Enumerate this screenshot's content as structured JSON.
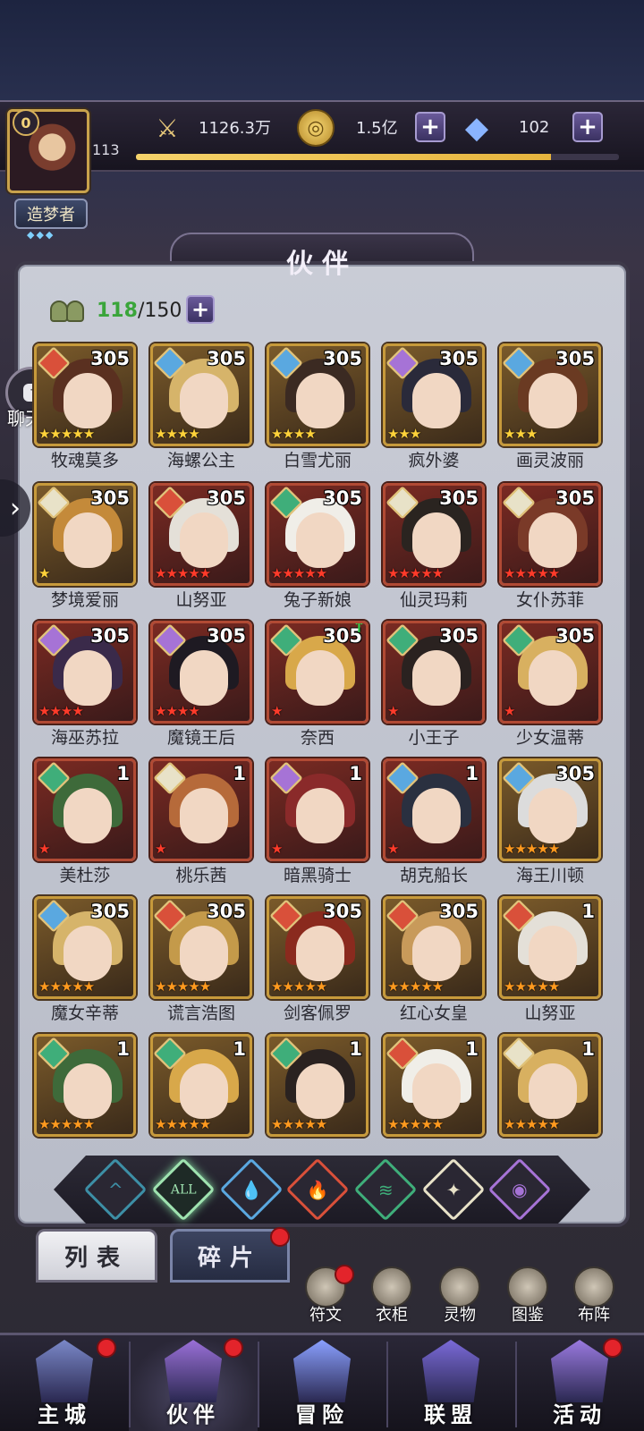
{
  "player": {
    "vip": "0",
    "level": "113",
    "title": "造梦者"
  },
  "resources": {
    "power": "1126.3万",
    "gold": "1.5亿",
    "gems": "102"
  },
  "exp_progress": 0.86,
  "header": {
    "title": "伙伴"
  },
  "roster": {
    "current": "118",
    "max": "/150"
  },
  "chat": {
    "label": "聊天",
    "bubble": "···"
  },
  "heroes": [
    {
      "name": "牧魂莫多",
      "level": "305",
      "stars": 5,
      "star_color": "gold",
      "element": "fire",
      "frame": "gold",
      "hair": "#5a3020"
    },
    {
      "name": "海螺公主",
      "level": "305",
      "stars": 4,
      "star_color": "gold",
      "element": "water",
      "frame": "gold",
      "hair": "#d6b46a"
    },
    {
      "name": "白雪尤丽",
      "level": "305",
      "stars": 4,
      "star_color": "gold",
      "element": "water",
      "frame": "gold",
      "hair": "#3b2a22"
    },
    {
      "name": "疯外婆",
      "level": "305",
      "stars": 3,
      "star_color": "gold",
      "element": "dark",
      "frame": "gold",
      "hair": "#2a2a3a"
    },
    {
      "name": "画灵波丽",
      "level": "305",
      "stars": 3,
      "star_color": "gold",
      "element": "water",
      "frame": "gold",
      "hair": "#6a3a22"
    },
    {
      "name": "梦境爱丽",
      "level": "305",
      "stars": 1,
      "star_color": "gold",
      "element": "light",
      "frame": "gold",
      "hair": "#c48a3a"
    },
    {
      "name": "山努亚",
      "level": "305",
      "stars": 5,
      "star_color": "red",
      "element": "fire",
      "frame": "red",
      "hair": "#e4e0d8"
    },
    {
      "name": "兔子新娘",
      "level": "305",
      "stars": 5,
      "star_color": "red",
      "element": "wind",
      "frame": "red",
      "hair": "#f0eee8"
    },
    {
      "name": "仙灵玛莉",
      "level": "305",
      "stars": 5,
      "star_color": "red",
      "element": "light",
      "frame": "red",
      "hair": "#2a2420"
    },
    {
      "name": "女仆苏菲",
      "level": "305",
      "stars": 5,
      "star_color": "red",
      "element": "light",
      "frame": "red",
      "hair": "#7a3a28"
    },
    {
      "name": "海巫苏拉",
      "level": "305",
      "stars": 4,
      "star_color": "red",
      "element": "dark",
      "frame": "red",
      "hair": "#3a2a4a"
    },
    {
      "name": "魔镜王后",
      "level": "305",
      "stars": 4,
      "star_color": "red",
      "element": "dark",
      "frame": "red",
      "hair": "#1e1a22"
    },
    {
      "name": "奈西",
      "level": "305",
      "stars": 1,
      "star_color": "red",
      "element": "wind",
      "frame": "red",
      "hair": "#d8a84a",
      "arrow": "↑"
    },
    {
      "name": "小王子",
      "level": "305",
      "stars": 1,
      "star_color": "red",
      "element": "wind",
      "frame": "red",
      "hair": "#2a2220"
    },
    {
      "name": "少女温蒂",
      "level": "305",
      "stars": 1,
      "star_color": "red",
      "element": "wind",
      "frame": "red",
      "hair": "#d8b060"
    },
    {
      "name": "美杜莎",
      "level": "1",
      "stars": 1,
      "star_color": "red",
      "element": "wind",
      "frame": "red",
      "hair": "#3e6a3a"
    },
    {
      "name": "桃乐茜",
      "level": "1",
      "stars": 1,
      "star_color": "red",
      "element": "light",
      "frame": "red",
      "hair": "#b66a3a"
    },
    {
      "name": "暗黑骑士",
      "level": "1",
      "stars": 1,
      "star_color": "red",
      "element": "dark",
      "frame": "red",
      "hair": "#8a2a2a"
    },
    {
      "name": "胡克船长",
      "level": "1",
      "stars": 1,
      "star_color": "red",
      "element": "water",
      "frame": "red",
      "hair": "#2a3040"
    },
    {
      "name": "海王川顿",
      "level": "305",
      "stars": 5,
      "star_color": "orange",
      "element": "water",
      "frame": "gold",
      "hair": "#dcdcdc"
    },
    {
      "name": "魔女辛蒂",
      "level": "305",
      "stars": 5,
      "star_color": "orange",
      "element": "water",
      "frame": "gold",
      "hair": "#d6b46a"
    },
    {
      "name": "谎言浩图",
      "level": "305",
      "stars": 5,
      "star_color": "orange",
      "element": "fire",
      "frame": "gold",
      "hair": "#c49a4a"
    },
    {
      "name": "剑客佩罗",
      "level": "305",
      "stars": 5,
      "star_color": "orange",
      "element": "fire",
      "frame": "gold",
      "hair": "#8a2a1e"
    },
    {
      "name": "红心女皇",
      "level": "305",
      "stars": 5,
      "star_color": "orange",
      "element": "fire",
      "frame": "gold",
      "hair": "#c89a5a"
    },
    {
      "name": "山努亚",
      "level": "1",
      "stars": 5,
      "star_color": "orange",
      "element": "fire",
      "frame": "gold",
      "hair": "#e4e0d8"
    },
    {
      "name": "",
      "level": "1",
      "stars": 5,
      "star_color": "orange",
      "element": "wind",
      "frame": "gold",
      "hair": "#3e6a3a"
    },
    {
      "name": "",
      "level": "1",
      "stars": 5,
      "star_color": "orange",
      "element": "wind",
      "frame": "gold",
      "hair": "#d8a84a"
    },
    {
      "name": "",
      "level": "1",
      "stars": 5,
      "star_color": "orange",
      "element": "wind",
      "frame": "gold",
      "hair": "#2a2220"
    },
    {
      "name": "",
      "level": "1",
      "stars": 5,
      "star_color": "orange",
      "element": "fire",
      "frame": "gold",
      "hair": "#f0eee8"
    },
    {
      "name": "",
      "level": "1",
      "stars": 5,
      "star_color": "orange",
      "element": "light",
      "frame": "gold",
      "hair": "#d8b060"
    }
  ],
  "element_colors": {
    "fire": "#d9503a",
    "water": "#5aa8e0",
    "wind": "#3fae7a",
    "light": "#e8e2c8",
    "dark": "#a673d6",
    "all": "#9fe3b0",
    "forest": "#3d8fa6"
  },
  "filters": [
    {
      "key": "forest",
      "icon": "^"
    },
    {
      "key": "all",
      "icon": "ALL"
    },
    {
      "key": "water",
      "icon": "💧"
    },
    {
      "key": "fire",
      "icon": "🔥"
    },
    {
      "key": "wind",
      "icon": "≋"
    },
    {
      "key": "light",
      "icon": "✦"
    },
    {
      "key": "dark",
      "icon": "◉"
    }
  ],
  "tabs": {
    "list": "列表",
    "fragments": "碎片"
  },
  "tools": [
    {
      "label": "符文"
    },
    {
      "label": "衣柜"
    },
    {
      "label": "灵物"
    },
    {
      "label": "图鉴"
    },
    {
      "label": "布阵"
    }
  ],
  "nav": [
    {
      "label": "主城"
    },
    {
      "label": "伙伴"
    },
    {
      "label": "冒险"
    },
    {
      "label": "联盟"
    },
    {
      "label": "活动"
    }
  ]
}
